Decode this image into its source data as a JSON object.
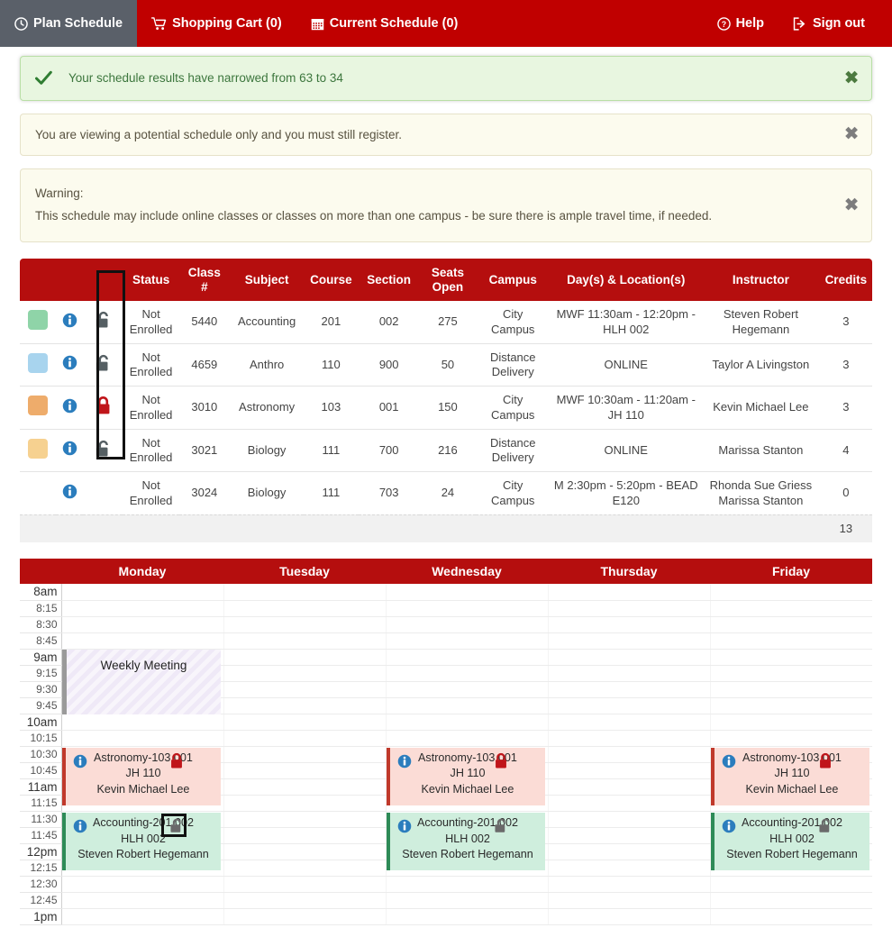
{
  "navbar": {
    "brand_color": "#c00000",
    "active_bg": "#5a6069",
    "left_items": [
      {
        "label": "Plan Schedule",
        "icon": "clock-icon",
        "active": true
      },
      {
        "label": "Shopping Cart (0)",
        "icon": "shopping-cart-icon",
        "active": false
      },
      {
        "label": "Current Schedule (0)",
        "icon": "calendar-icon",
        "active": false
      }
    ],
    "right_items": [
      {
        "label": "Help",
        "icon": "question-circle-icon"
      },
      {
        "label": "Sign out",
        "icon": "sign-out-icon"
      }
    ]
  },
  "alerts": [
    {
      "type": "success",
      "icon": "check-icon",
      "text": "Your schedule results have narrowed from 63 to 34",
      "close": "✖"
    },
    {
      "type": "warning",
      "text": "You are viewing a potential schedule only and you must still register.",
      "close": "✖"
    },
    {
      "type": "warning",
      "title": "Warning:",
      "text": "This schedule may include online classes or classes on more than one campus - be sure there is ample travel time, if needed.",
      "close": "✖"
    }
  ],
  "course_table": {
    "headers": [
      "",
      "",
      "",
      "Status",
      "Class #",
      "Subject",
      "Course",
      "Section",
      "Seats Open",
      "Campus",
      "Day(s) & Location(s)",
      "Instructor",
      "Credits"
    ],
    "header_class_line1": "Class",
    "header_class_line2": "#",
    "header_seats_line1": "Seats",
    "header_seats_line2": "Open",
    "rows": [
      {
        "swatch": "#8fd4a8",
        "info_icon": "info-icon",
        "lock_icon": "unlock-icon",
        "lock_color": "#555f63",
        "status": "Not Enrolled",
        "class_num": "5440",
        "subject": "Accounting",
        "course": "201",
        "section": "002",
        "seats_open": "275",
        "campus": "City Campus",
        "days_locations": "MWF 11:30am - 12:20pm - HLH 002",
        "instructor": "Steven Robert Hegemann",
        "credits": "3"
      },
      {
        "swatch": "#a8d4ee",
        "info_icon": "info-icon",
        "lock_icon": "unlock-icon",
        "lock_color": "#555f63",
        "status": "Not Enrolled",
        "class_num": "4659",
        "subject": "Anthro",
        "course": "110",
        "section": "900",
        "seats_open": "50",
        "campus": "Distance Delivery",
        "days_locations": "ONLINE",
        "instructor": "Taylor A Livingston",
        "credits": "3"
      },
      {
        "swatch": "#eeac6b",
        "info_icon": "info-icon",
        "lock_icon": "lock-icon",
        "lock_color": "#c0151a",
        "status": "Not Enrolled",
        "class_num": "3010",
        "subject": "Astronomy",
        "course": "103",
        "section": "001",
        "seats_open": "150",
        "campus": "City Campus",
        "days_locations": "MWF 10:30am - 11:20am - JH 110",
        "instructor": "Kevin Michael Lee",
        "credits": "3"
      },
      {
        "swatch": "#f6d190",
        "info_icon": "info-icon",
        "lock_icon": "unlock-icon",
        "lock_color": "#555f63",
        "status": "Not Enrolled",
        "class_num": "3021",
        "subject": "Biology",
        "course": "111",
        "section": "700",
        "seats_open": "216",
        "campus": "Distance Delivery",
        "days_locations": "ONLINE",
        "instructor": "Marissa Stanton",
        "credits": "4"
      },
      {
        "swatch": null,
        "info_icon": "info-icon",
        "lock_icon": null,
        "lock_color": null,
        "status": "Not Enrolled",
        "class_num": "3024",
        "subject": "Biology",
        "course": "111",
        "section": "703",
        "seats_open": "24",
        "campus": "City Campus",
        "days_locations": "M 2:30pm - 5:20pm - BEAD E120",
        "instructor": "Rhonda Sue Griess Marissa Stanton",
        "credits": "0"
      }
    ],
    "total_credits": "13"
  },
  "calendar": {
    "days": [
      "Monday",
      "Tuesday",
      "Wednesday",
      "Thursday",
      "Friday"
    ],
    "times": [
      "8am",
      "8:15",
      "8:30",
      "8:45",
      "9am",
      "9:15",
      "9:30",
      "9:45",
      "10am",
      "10:15",
      "10:30",
      "10:45",
      "11am",
      "11:15",
      "11:30",
      "11:45",
      "12pm",
      "12:15",
      "12:30",
      "12:45",
      "1pm"
    ],
    "events": [
      {
        "id": "weekly-meeting-mon",
        "kind": "meeting",
        "day": "Monday",
        "title": "Weekly Meeting",
        "location": "",
        "instructor": "",
        "lock_icon": null,
        "start": "9am",
        "end": "10am"
      },
      {
        "id": "astronomy-mon",
        "kind": "astro",
        "day": "Monday",
        "title": "Astronomy-103 001",
        "location": "JH 110",
        "instructor": "Kevin Michael Lee",
        "lock_icon": "lock-icon",
        "lock_color": "#c0151a",
        "info_icon": "info-icon",
        "start": "10:30",
        "end": "11:20am"
      },
      {
        "id": "accounting-mon",
        "kind": "acct",
        "day": "Monday",
        "title": "Accounting-201 002",
        "location": "HLH 002",
        "instructor": "Steven Robert Hegemann",
        "lock_icon": "unlock-icon",
        "lock_color": "#6a6a6a",
        "info_icon": "info-icon",
        "start": "11:30",
        "end": "12:20pm",
        "highlighted": true
      },
      {
        "id": "astronomy-wed",
        "kind": "astro",
        "day": "Wednesday",
        "title": "Astronomy-103 001",
        "location": "JH 110",
        "instructor": "Kevin Michael Lee",
        "lock_icon": "lock-icon",
        "lock_color": "#c0151a",
        "info_icon": "info-icon",
        "start": "10:30",
        "end": "11:20am"
      },
      {
        "id": "accounting-wed",
        "kind": "acct",
        "day": "Wednesday",
        "title": "Accounting-201 002",
        "location": "HLH 002",
        "instructor": "Steven Robert Hegemann",
        "lock_icon": "unlock-icon",
        "lock_color": "#6a6a6a",
        "info_icon": "info-icon",
        "start": "11:30",
        "end": "12:20pm"
      },
      {
        "id": "astronomy-fri",
        "kind": "astro",
        "day": "Friday",
        "title": "Astronomy-103 001",
        "location": "JH 110",
        "instructor": "Kevin Michael Lee",
        "lock_icon": "lock-icon",
        "lock_color": "#c0151a",
        "info_icon": "info-icon",
        "start": "10:30",
        "end": "11:20am"
      },
      {
        "id": "accounting-fri",
        "kind": "acct",
        "day": "Friday",
        "title": "Accounting-201 002",
        "location": "HLH 002",
        "instructor": "Steven Robert Hegemann",
        "lock_icon": "unlock-icon",
        "lock_color": "#6a6a6a",
        "info_icon": "info-icon",
        "start": "11:30",
        "end": "12:20pm"
      }
    ]
  }
}
